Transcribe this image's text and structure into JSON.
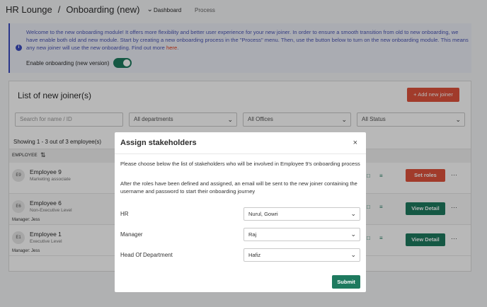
{
  "header": {
    "app": "HR Lounge",
    "separator": "/",
    "page": "Onboarding (new)",
    "tabs": [
      "Dashboard",
      "Process"
    ]
  },
  "banner": {
    "text": "Welcome to the new onboarding module! It offers more flexibility and better user experience for your new joiner. In order to ensure a smooth transition from old to new onboarding, we have enable both old and new module. Start by creating a new onboarding process in the \"Process\" menu. Then, use the button below to turn on the new onboarding module. This means any new joiner will use the new onboarding. Find out more ",
    "link": "here",
    "link_suffix": ".",
    "toggle_label": "Enable onboarding (new version)",
    "toggle_on": true
  },
  "list": {
    "title": "List of new joiner(s)",
    "add_button": "+ Add new joiner",
    "search_placeholder": "Search for name / ID",
    "departments": "All departments",
    "offices": "All Offices",
    "status": "All Status",
    "count": "Showing 1 - 3 out of 3 employee(s)",
    "column_employee": "EMPLOYEE",
    "rows": [
      {
        "initials": "E9",
        "name": "Employee 9",
        "role": "Marketing associate",
        "manager": "",
        "action": "Set roles"
      },
      {
        "initials": "E6",
        "name": "Employee 6",
        "role": "Non-Executive Level",
        "manager": "Manager: Jess",
        "action": "View Detail"
      },
      {
        "initials": "E1",
        "name": "Employee 1",
        "role": "Executive Level",
        "manager": "Manager: Jess",
        "action": "View Detail"
      }
    ]
  },
  "modal": {
    "title": "Assign stakeholders",
    "close": "×",
    "p1": "Please choose below the list of stakeholders who will be involved in Employee 9's onboarding process",
    "p2": "After the roles have been defined and assigned, an email will be sent to the new joiner containing the username and password to start their onboarding journey",
    "fields": [
      {
        "label": "HR",
        "value": "Nurul, Gowri"
      },
      {
        "label": "Manager",
        "value": "Raj"
      },
      {
        "label": "Head Of Department",
        "value": "Hafiz"
      }
    ],
    "submit": "Submit"
  },
  "colors": {
    "accent_green": "#1e7a5f",
    "accent_red": "#e0533c",
    "banner_text": "#4a55b5"
  }
}
